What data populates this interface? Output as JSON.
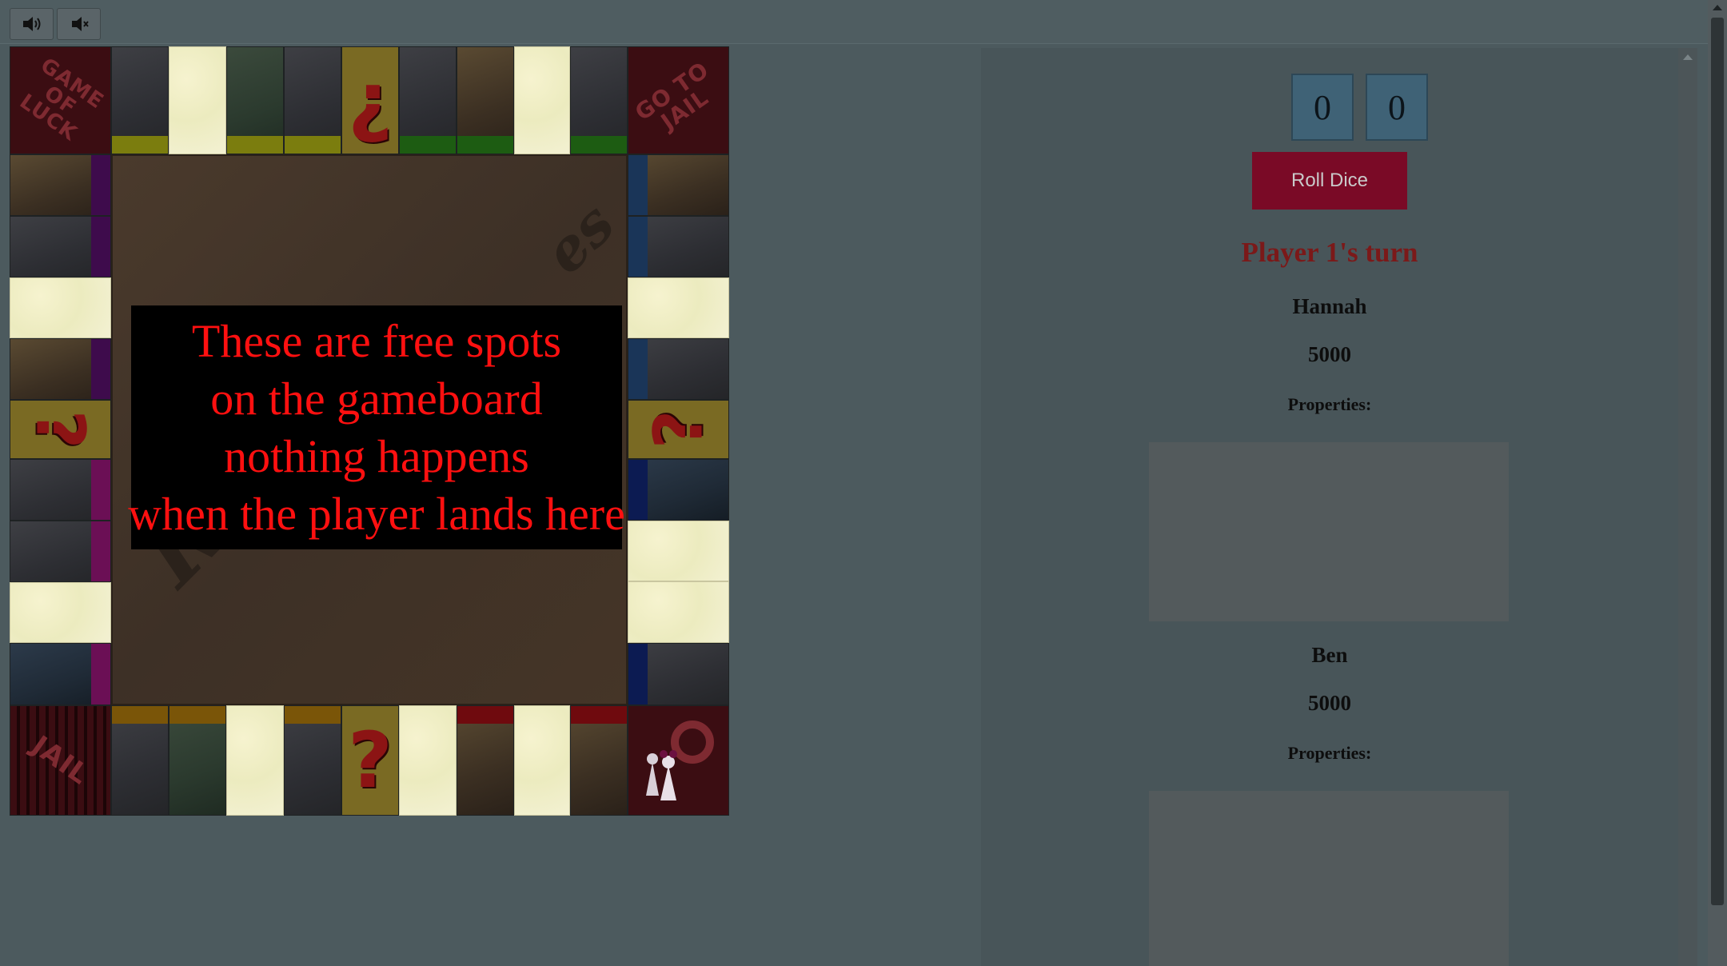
{
  "toolbar": {
    "sound_on_icon": "speaker-on-icon",
    "sound_off_icon": "speaker-mute-icon"
  },
  "board": {
    "corners": {
      "top_left": "GAME OF LUCK",
      "top_right": "GO TO JAIL",
      "bottom_left": "JAIL",
      "bottom_right_icon": "pawns-start-icon"
    },
    "chance_symbol_top": "¿",
    "chance_symbol_side": "?",
    "logo_text_1": "Rags",
    "logo_text_2": "es",
    "popup": {
      "line1": "These are free spots",
      "line2": "on the gameboard",
      "line3": "nothing happens",
      "line4": "when the player lands here"
    },
    "colors": {
      "yellow_group": "#7b7d0e",
      "green_group": "#1d5c12",
      "blue_group": "#1a3558",
      "navy_group": "#0c1b52",
      "purple_group": "#3e0b4c",
      "magenta_group": "#6b0f55",
      "orange_group": "#7a5508",
      "red_group": "#6f0a0e"
    }
  },
  "dice": {
    "die1": "0",
    "die2": "0"
  },
  "controls": {
    "roll_label": "Roll Dice"
  },
  "turn_text": "Player 1's turn",
  "players": [
    {
      "name": "Hannah",
      "money": "5000",
      "properties_label": "Properties:"
    },
    {
      "name": "Ben",
      "money": "5000",
      "properties_label": "Properties:"
    }
  ]
}
